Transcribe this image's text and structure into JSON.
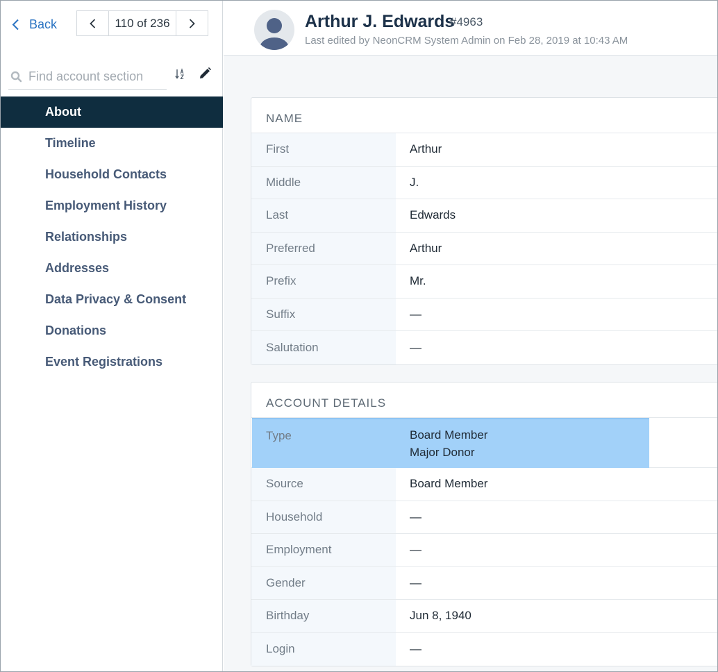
{
  "sidebar": {
    "back_label": "Back",
    "pager_label": "110 of 236",
    "search_placeholder": "Find account section",
    "nav": [
      {
        "label": "About",
        "active": true
      },
      {
        "label": "Timeline"
      },
      {
        "label": "Household Contacts"
      },
      {
        "label": "Employment History"
      },
      {
        "label": "Relationships"
      },
      {
        "label": "Addresses"
      },
      {
        "label": "Data Privacy & Consent"
      },
      {
        "label": "Donations"
      },
      {
        "label": "Event Registrations"
      }
    ]
  },
  "header": {
    "name": "Arthur J. Edwards",
    "account_id": "#4963",
    "last_edited": "Last edited by NeonCRM System Admin on Feb 28, 2019 at 10:43 AM"
  },
  "name_card": {
    "title": "NAME",
    "rows": [
      {
        "label": "First",
        "value": "Arthur"
      },
      {
        "label": "Middle",
        "value": "J."
      },
      {
        "label": "Last",
        "value": "Edwards"
      },
      {
        "label": "Preferred",
        "value": "Arthur"
      },
      {
        "label": "Prefix",
        "value": "Mr."
      },
      {
        "label": "Suffix",
        "value": "—"
      },
      {
        "label": "Salutation",
        "value": "—"
      }
    ]
  },
  "account_card": {
    "title": "ACCOUNT DETAILS",
    "type_label": "Type",
    "type_values": [
      "Board Member",
      "Major Donor"
    ],
    "rows": [
      {
        "label": "Source",
        "value": "Board Member"
      },
      {
        "label": "Household",
        "value": "—"
      },
      {
        "label": "Employment",
        "value": "—"
      },
      {
        "label": "Gender",
        "value": "—"
      },
      {
        "label": "Birthday",
        "value": "Jun 8, 1940"
      },
      {
        "label": "Login",
        "value": "—"
      }
    ]
  },
  "colors": {
    "accent": "#2a73c2",
    "nav_active_bg": "#0f2d3f",
    "highlight": "#a2d1f9"
  }
}
